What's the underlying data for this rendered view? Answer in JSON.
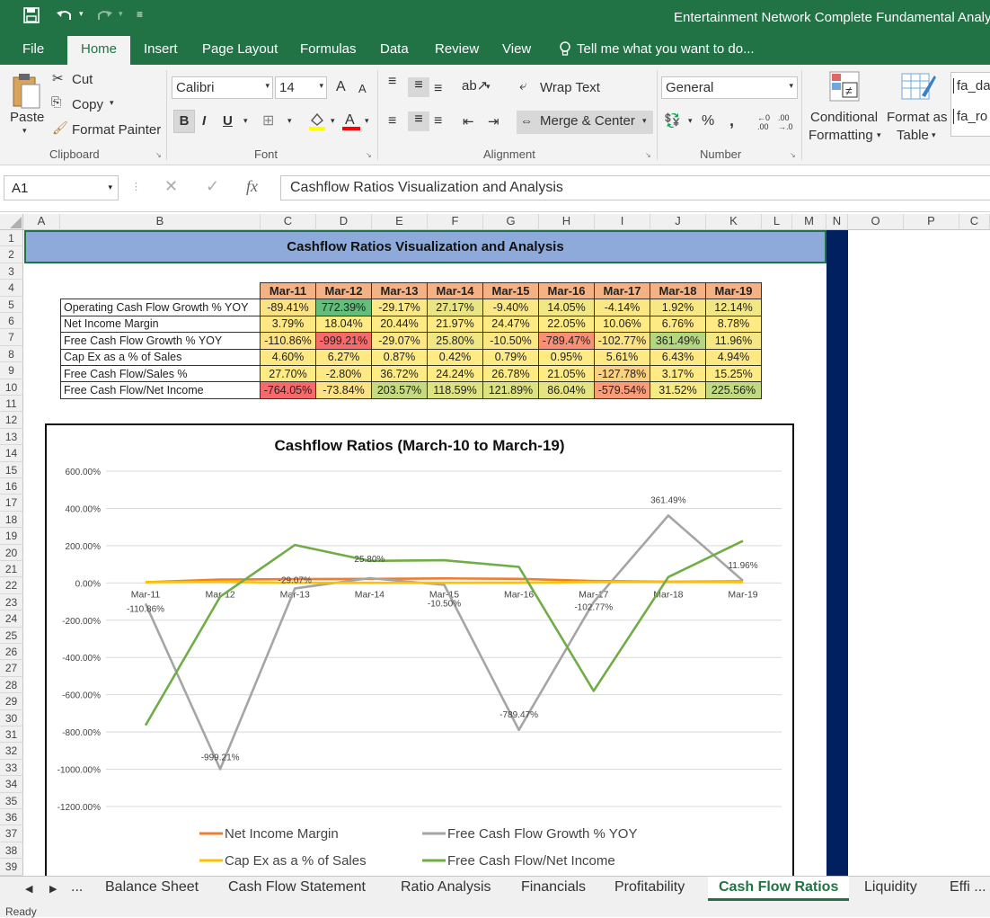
{
  "app": {
    "window_title": "Entertainment Network Complete Fundamental Analy",
    "quick_access": {
      "save_icon": "save-icon",
      "undo_icon": "undo-icon",
      "redo_icon": "redo-icon",
      "customize_icon": "customize-quick-access-icon"
    }
  },
  "ribbon_tabs": [
    "File",
    "Home",
    "Insert",
    "Page Layout",
    "Formulas",
    "Data",
    "Review",
    "View"
  ],
  "active_ribbon_tab": "Home",
  "tell_me": "Tell me what you want to do...",
  "ribbon": {
    "clipboard": {
      "paste": "Paste",
      "cut": "Cut",
      "copy": "Copy",
      "format_painter": "Format Painter",
      "label": "Clipboard"
    },
    "font": {
      "family": "Calibri",
      "size": "14",
      "bold": "B",
      "italic": "I",
      "underline": "U",
      "grow": "A",
      "shrink": "A",
      "label": "Font"
    },
    "alignment": {
      "wrap_text": "Wrap Text",
      "merge_center": "Merge & Center",
      "label": "Alignment"
    },
    "number": {
      "format": "General",
      "percent": "%",
      "comma": ",",
      "inc_decimal": ".00",
      "dec_decimal": ".0",
      "label": "Number"
    },
    "styles": {
      "conditional_formatting_line1": "Conditional",
      "conditional_formatting_line2": "Formatting",
      "format_as_table_line1": "Format as",
      "format_as_table_line2": "Table",
      "style1": "fa_da",
      "style2": "fa_ro"
    }
  },
  "formula_bar": {
    "name_box": "A1",
    "fx": "fx",
    "content": "Cashflow Ratios Visualization and Analysis"
  },
  "columns": [
    "A",
    "B",
    "C",
    "D",
    "E",
    "F",
    "G",
    "H",
    "I",
    "J",
    "K",
    "L",
    "M",
    "N",
    "O",
    "P",
    "C"
  ],
  "rows": [
    "1",
    "2",
    "3",
    "4",
    "5",
    "6",
    "7",
    "8",
    "9",
    "10",
    "11",
    "12",
    "13",
    "14",
    "15",
    "16",
    "17",
    "18",
    "19",
    "20",
    "21",
    "22",
    "23",
    "24",
    "25",
    "26",
    "27",
    "28",
    "29",
    "30",
    "31",
    "32",
    "33",
    "34",
    "35",
    "36",
    "37",
    "38",
    "39"
  ],
  "sheet": {
    "banner_title": "Cashflow Ratios Visualization and Analysis",
    "table": {
      "headers": [
        "Mar-11",
        "Mar-12",
        "Mar-13",
        "Mar-14",
        "Mar-15",
        "Mar-16",
        "Mar-17",
        "Mar-18",
        "Mar-19"
      ],
      "rows": [
        {
          "label": "Operating Cash Flow Growth % YOY",
          "values": [
            "-89.41%",
            "772.39%",
            "-29.17%",
            "27.17%",
            "-9.40%",
            "14.05%",
            "-4.14%",
            "1.92%",
            "12.14%"
          ],
          "colors": [
            "#fbe383",
            "#63be7b",
            "#fce884",
            "#eae583",
            "#fae884",
            "#f1e784",
            "#fbe884",
            "#f7e884",
            "#f1e784"
          ]
        },
        {
          "label": "Net Income Margin",
          "values": [
            "3.79%",
            "18.04%",
            "20.44%",
            "21.97%",
            "24.47%",
            "22.05%",
            "10.06%",
            "6.76%",
            "8.78%"
          ],
          "colors": [
            "#fde883",
            "#ffeb84",
            "#ffeb84",
            "#ffeb84",
            "#ffeb84",
            "#ffeb84",
            "#ffeb84",
            "#fee984",
            "#ffea84"
          ]
        },
        {
          "label": "Free Cash Flow Growth % YOY",
          "values": [
            "-110.86%",
            "-999.21%",
            "-29.07%",
            "25.80%",
            "-10.50%",
            "-789.47%",
            "-102.77%",
            "361.49%",
            "11.96%"
          ],
          "colors": [
            "#fde283",
            "#f8696b",
            "#fde883",
            "#f0e784",
            "#fbe884",
            "#f98f75",
            "#fde283",
            "#b5d680",
            "#f5e884"
          ]
        },
        {
          "label": "Cap Ex as a % of Sales",
          "values": [
            "4.60%",
            "6.27%",
            "0.87%",
            "0.42%",
            "0.79%",
            "0.95%",
            "5.61%",
            "6.43%",
            "4.94%"
          ],
          "colors": [
            "#fde984",
            "#fee984",
            "#ffeb84",
            "#ffeb84",
            "#ffeb84",
            "#ffeb84",
            "#fee984",
            "#fee984",
            "#fde984"
          ]
        },
        {
          "label": "Free Cash Flow/Sales %",
          "values": [
            "27.70%",
            "-2.80%",
            "36.72%",
            "24.24%",
            "26.78%",
            "21.05%",
            "-127.78%",
            "3.17%",
            "15.25%"
          ],
          "colors": [
            "#ffeb84",
            "#fee984",
            "#ffeb84",
            "#ffeb84",
            "#ffeb84",
            "#ffeb84",
            "#fbd07f",
            "#ffea84",
            "#ffeb84"
          ]
        },
        {
          "label": "Free Cash Flow/Net Income",
          "values": [
            "-764.05%",
            "-73.84%",
            "203.57%",
            "118.59%",
            "121.89%",
            "86.04%",
            "-579.54%",
            "31.52%",
            "225.56%"
          ],
          "colors": [
            "#f8696b",
            "#fde283",
            "#c6db81",
            "#dde282",
            "#dce182",
            "#e5e483",
            "#fa9c77",
            "#f7e984",
            "#c1da81"
          ]
        }
      ]
    }
  },
  "chart_data": {
    "type": "line",
    "title": "Cashflow Ratios  (March-10 to March-19)",
    "categories": [
      "Mar-11",
      "Mar-12",
      "Mar-13",
      "Mar-14",
      "Mar-15",
      "Mar-16",
      "Mar-17",
      "Mar-18",
      "Mar-19"
    ],
    "ylim": [
      -1200,
      600
    ],
    "yticks": [
      600,
      400,
      200,
      0,
      -200,
      -400,
      -600,
      -800,
      -1000,
      -1200
    ],
    "ytick_labels": [
      "600.00%",
      "400.00%",
      "200.00%",
      "0.00%",
      "-200.00%",
      "-400.00%",
      "-600.00%",
      "-800.00%",
      "-1000.00%",
      "-1200.00%"
    ],
    "grid": true,
    "legend_position": "bottom",
    "series": [
      {
        "name": "Net Income Margin",
        "color": "#ed7d31",
        "values": [
          3.79,
          18.04,
          20.44,
          21.97,
          24.47,
          22.05,
          10.06,
          6.76,
          8.78
        ],
        "labels": []
      },
      {
        "name": "Free Cash Flow Growth % YOY",
        "color": "#a5a5a5",
        "values": [
          -110.86,
          -999.21,
          -29.07,
          25.8,
          -10.5,
          -789.47,
          -102.77,
          361.49,
          11.96
        ],
        "labels": [
          "-110.86%",
          "-999.21%",
          "-29.07%",
          "25.80%",
          "-10.50%",
          "-789.47%",
          "-102.77%",
          "361.49%",
          "11.96%"
        ]
      },
      {
        "name": "Cap Ex as a % of Sales",
        "color": "#ffc000",
        "values": [
          4.6,
          6.27,
          0.87,
          0.42,
          0.79,
          0.95,
          5.61,
          6.43,
          4.94
        ],
        "labels": []
      },
      {
        "name": "Free Cash Flow/Net Income",
        "color": "#70ad47",
        "values": [
          -764.05,
          -73.84,
          203.57,
          118.59,
          121.89,
          86.04,
          -579.54,
          31.52,
          225.56
        ],
        "labels": []
      }
    ]
  },
  "sheet_tabs": [
    "...",
    "Balance Sheet",
    "Cash Flow Statement",
    "Ratio Analysis",
    "Financials",
    "Profitability",
    "Cash Flow Ratios",
    "Liquidity",
    "Effi ..."
  ],
  "active_sheet": "Cash Flow Ratios",
  "status": "Ready"
}
